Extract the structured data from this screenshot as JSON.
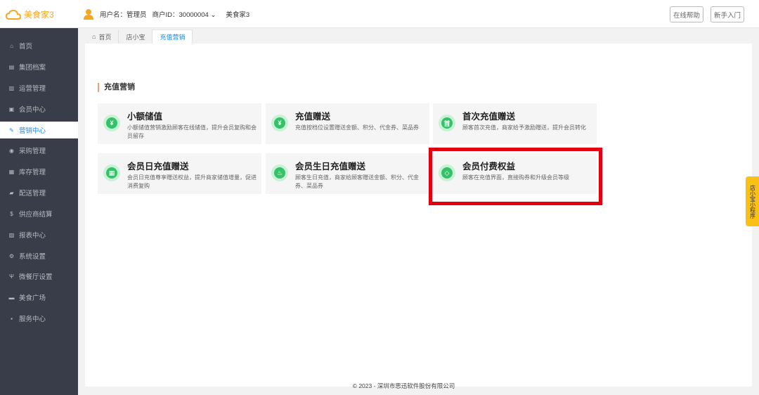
{
  "header": {
    "logo_text": "美食家3",
    "user_label": "用户名：管理员",
    "merchant_label": "商户ID：30000004",
    "merchant_caret": "⌄",
    "store_name": "美食家3",
    "help_button": "在线帮助",
    "newbie_button": "新手入门"
  },
  "sidebar": {
    "items": [
      {
        "label": "首页",
        "icon": "home-icon",
        "glyph": "⌂"
      },
      {
        "label": "集团档案",
        "icon": "archive-icon",
        "glyph": "▤"
      },
      {
        "label": "运营管理",
        "icon": "chart-icon",
        "glyph": "▥"
      },
      {
        "label": "会员中心",
        "icon": "member-card-icon",
        "glyph": "▣"
      },
      {
        "label": "营销中心",
        "icon": "edit-icon",
        "glyph": "✎"
      },
      {
        "label": "采购管理",
        "icon": "purchase-icon",
        "glyph": "◉"
      },
      {
        "label": "库存管理",
        "icon": "inventory-icon",
        "glyph": "▦"
      },
      {
        "label": "配送管理",
        "icon": "truck-icon",
        "glyph": "▰"
      },
      {
        "label": "供应商结算",
        "icon": "dollar-icon",
        "glyph": "$"
      },
      {
        "label": "报表中心",
        "icon": "report-icon",
        "glyph": "▧"
      },
      {
        "label": "系统设置",
        "icon": "settings-icon",
        "glyph": "⚙"
      },
      {
        "label": "微餐厅设置",
        "icon": "restaurant-icon",
        "glyph": "Ψ"
      },
      {
        "label": "美食广场",
        "icon": "plaza-icon",
        "glyph": "▬"
      },
      {
        "label": "服务中心",
        "icon": "service-icon",
        "glyph": "▪"
      }
    ],
    "active_index": 4
  },
  "tabs": [
    {
      "label": "首页",
      "icon": "home-icon"
    },
    {
      "label": "店小宝"
    },
    {
      "label": "充值营销"
    }
  ],
  "main": {
    "section_title": "充值营销",
    "cards": [
      {
        "title": "小额储值",
        "desc": "小额储值营销激励顾客在线储值，提升会员复购和会员留存",
        "icon": "yuan-coin-icon",
        "glyph": "¥"
      },
      {
        "title": "充值赠送",
        "desc": "充值按档位设置赠送金额、积分、代金券、菜品券",
        "icon": "gift-yuan-icon",
        "glyph": "¥"
      },
      {
        "title": "首次充值赠送",
        "desc": "顾客首次充值，商家给予激励赠送，提升会员转化",
        "icon": "first-recharge-icon",
        "glyph": "首"
      },
      {
        "title": "会员日充值赠送",
        "desc": "会员日充值尊享赠送权益，提升商家储值增量，促进消费复购",
        "icon": "calendar-icon",
        "glyph": "▦"
      },
      {
        "title": "会员生日充值赠送",
        "desc": "顾客生日充值，商家给顾客赠送金额、积分、代金券、菜品券",
        "icon": "birthday-cake-icon",
        "glyph": "♨"
      },
      {
        "title": "会员付费权益",
        "desc": "顾客在充值界面，直接购券和升级会员等级",
        "icon": "diamond-icon",
        "glyph": "◇"
      }
    ]
  },
  "float_tab": "店小宝小程序",
  "footer": "© 2023 - 深圳市思迅软件股份有限公司",
  "colors": {
    "sidebar_bg": "#393d49",
    "active_blue": "#1e88e5",
    "icon_green": "#34c268",
    "highlight_red": "#e00010",
    "float_yellow": "#f9c016",
    "logo_orange": "#f5a623"
  }
}
